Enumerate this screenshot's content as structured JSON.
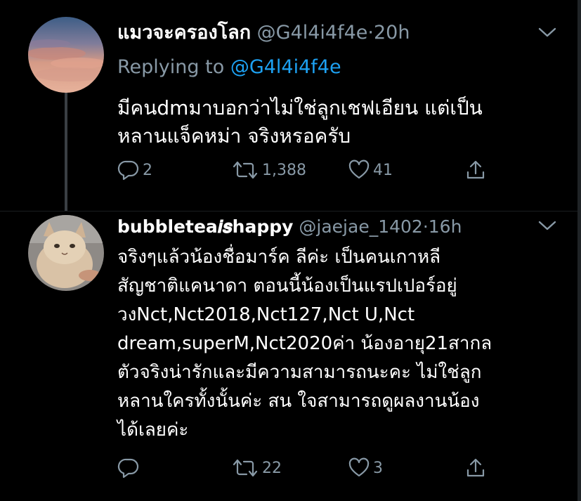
{
  "tweets": [
    {
      "display_name": "แมวจะครองโลก",
      "handle": "@G4l4i4f4e",
      "separator": "·",
      "time": "20h",
      "replying_label": "Replying to",
      "replying_mention": "@G4l4i4f4e",
      "lines": [
        "มีคนdmมาบอกว่าไม่ใช่ลูกเชฟเอียน แต่เป็น",
        "หลานแจ็คหม่า จริงหรอครับ"
      ],
      "replies": "2",
      "retweets": "1,388",
      "likes": "41"
    },
    {
      "display_name": "bubbletea𝒊𝒔happy",
      "handle": "@jaejae_1402",
      "separator": "·",
      "time": "16h",
      "lines": [
        "จริงๆแล้วน้องชื่อมาร์ค ลีค่ะ เป็นคนเกาหลี",
        "สัญชาติแคนาดา ตอนนี้น้องเป็นแรปเปอร์อยู่",
        "วงNct,Nct2018,Nct127,Nct U,Nct",
        "dream,superM,Nct2020ค่า น้องอายุ21สากล",
        "ตัวจริงน่ารักและมีความสามารถนะคะ ไม่ใช่ลูก",
        "หลานใครทั้งนั้นค่ะ สน ใจสามารถดูผลงานน้อง",
        "ได้เลยค่ะ"
      ],
      "replies": "",
      "retweets": "22",
      "likes": "3"
    }
  ],
  "icons": {
    "reply": "reply-icon",
    "retweet": "retweet-icon",
    "like": "heart-icon",
    "share": "share-icon",
    "more": "chevron-down-icon"
  },
  "colors": {
    "background": "#000000",
    "text": "#ffffff",
    "muted": "#8899a6",
    "link": "#1da1f2"
  }
}
